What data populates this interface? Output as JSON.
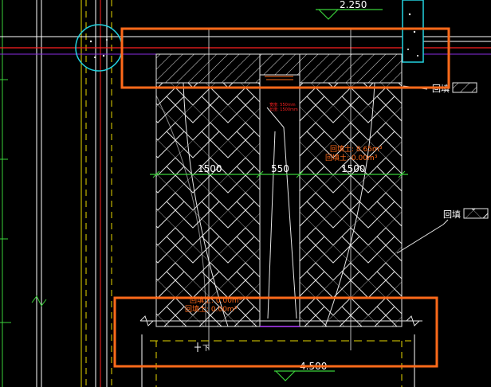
{
  "drawing": {
    "top_elevation": "2.250",
    "bottom_elevation": "4.500",
    "dims": {
      "left": "1500",
      "middle": "550",
      "right": "1500"
    },
    "label_upper_right": "回填",
    "label_mid_right": "回填",
    "note_right_line1": "回填土: 8.65m³",
    "note_right_line2": "回填土: 0.00m³",
    "note_bottom_line1": "回填土: 0.00m³",
    "note_bottom_line2": "回填土: 0.00m³",
    "note_center_line1": "宽度: 550mm",
    "note_center_line2": "长度: 1500mm",
    "bottom_small_label": "下"
  },
  "colors": {
    "background": "#000000",
    "orange": "#ff6a1a",
    "white": "#ffffff",
    "yellow": "#e8d800",
    "green": "#3ad13a",
    "red": "#ff2020",
    "cyan": "#23d3e0",
    "magenta": "#b23cff",
    "violet": "#8a2be2"
  }
}
